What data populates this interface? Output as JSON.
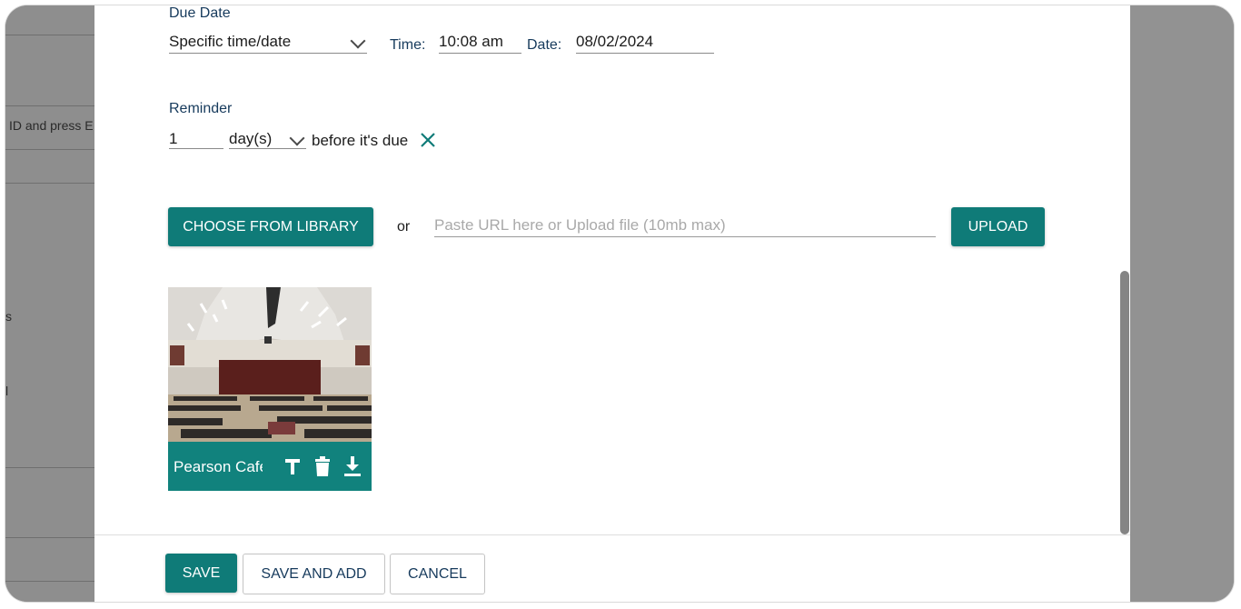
{
  "background": {
    "left_text_1": "ID and press E",
    "left_text_2": "s",
    "left_text_3": "l"
  },
  "due_date": {
    "label": "Due Date",
    "mode_value": "Specific time/date",
    "time_label": "Time:",
    "time_value": "10:08 am",
    "date_label": "Date:",
    "date_value": "08/02/2024"
  },
  "reminder": {
    "label": "Reminder",
    "amount": "1",
    "unit": "day(s)",
    "suffix": "before it's due"
  },
  "media": {
    "library_button": "CHOOSE FROM LIBRARY",
    "or_text": "or",
    "url_placeholder": "Paste URL here or Upload file (10mb max)",
    "upload_button": "UPLOAD",
    "thumbnail_name": "Pearson Cafeteria"
  },
  "footer": {
    "save": "SAVE",
    "save_and_add": "SAVE AND ADD",
    "cancel": "CANCEL"
  },
  "colors": {
    "accent": "#0f7b78",
    "label_text": "#163a5c",
    "overlay": "#8f8f8f"
  },
  "icons": [
    "chevron-down-icon",
    "close-icon",
    "text-icon",
    "trash-icon",
    "download-icon"
  ]
}
